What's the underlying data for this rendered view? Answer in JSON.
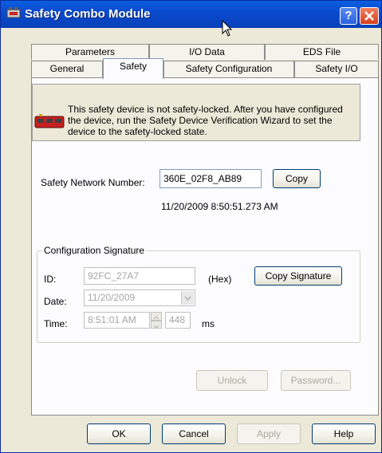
{
  "window": {
    "title": "Safety Combo Module",
    "help_glyph": "?"
  },
  "tabs_back": [
    {
      "label": "Parameters"
    },
    {
      "label": "I/O Data"
    },
    {
      "label": "EDS File"
    }
  ],
  "tabs_front": [
    {
      "label": "General"
    },
    {
      "label": "Safety",
      "active": true
    },
    {
      "label": "Safety Configuration"
    },
    {
      "label": "Safety I/O"
    }
  ],
  "notice": {
    "text": "This safety device is not safety-locked. After you have configured the device, run the Safety Device Verification Wizard to set the device to the safety-locked state.",
    "icon": "safety-device-icon"
  },
  "network": {
    "label": "Safety Network Number:",
    "value": "360E_02F8_AB89",
    "copy_label": "Copy",
    "timestamp": "11/20/2009 8:50:51.273 AM"
  },
  "config_signature": {
    "legend": "Configuration Signature",
    "id_label": "ID:",
    "id_value": "92FC_27A7",
    "hex_label": "(Hex)",
    "copy_signature_label": "Copy Signature",
    "date_label": "Date:",
    "date_value": "11/20/2009",
    "time_label": "Time:",
    "time_value": "8:51:01 AM",
    "ms_value": "448",
    "ms_label": "ms"
  },
  "lock_buttons": {
    "unlock": "Unlock",
    "password": "Password..."
  },
  "footer": {
    "ok": "OK",
    "cancel": "Cancel",
    "apply": "Apply",
    "help": "Help"
  },
  "colors": {
    "titlebar": "#0a4bd0",
    "dialog_bg": "#ece9d8",
    "close_red": "#d8401c"
  }
}
